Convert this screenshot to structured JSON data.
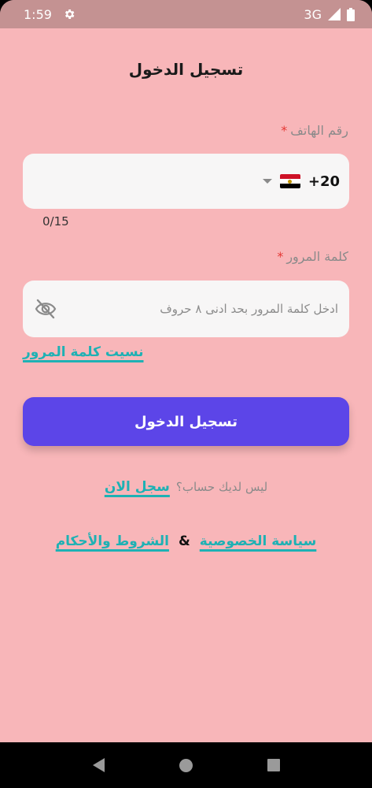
{
  "status_bar": {
    "time": "1:59",
    "network": "3G"
  },
  "title": "تسجيل الدخول",
  "phone": {
    "label": "رقم الهاتف",
    "required_mark": "*",
    "dial_code": "+20",
    "counter": "0/15"
  },
  "password": {
    "label": "كلمة المرور",
    "required_mark": "*",
    "placeholder": "ادخل كلمة المرور بحد ادنى ٨ حروف"
  },
  "forgot_password": "نسيت كلمة المرور",
  "login_button": "تسجيل الدخول",
  "signup": {
    "question": "ليس لديك حساب؟",
    "link": "سجل الان"
  },
  "legal": {
    "privacy": "سياسة الخصوصية",
    "amp": "&",
    "terms": "الشروط والأحكام"
  },
  "colors": {
    "background": "#f8b6b9",
    "accent_button": "#5c45e8",
    "link": "#1eb1b4",
    "required": "#e53935"
  },
  "icons": [
    "gear-icon",
    "signal-icon",
    "battery-icon",
    "egypt-flag-icon",
    "chevron-down-icon",
    "eye-off-icon",
    "nav-back-icon",
    "nav-home-icon",
    "nav-recents-icon"
  ]
}
